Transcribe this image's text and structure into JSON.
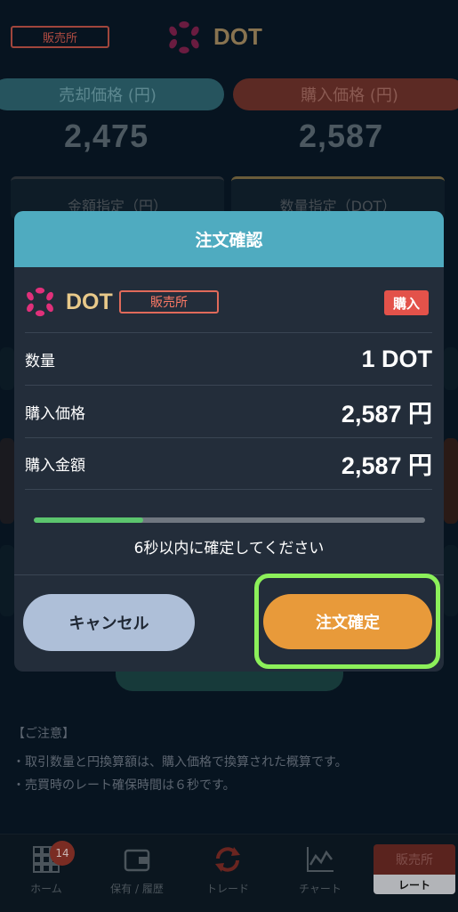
{
  "header": {
    "exchange_label": "販売所",
    "symbol": "DOT"
  },
  "prices": {
    "sell_label": "売却価格 (円)",
    "sell_value": "2,475",
    "buy_label": "購入価格 (円)",
    "buy_value": "2,587"
  },
  "modes": {
    "amount_label": "金額指定（円）",
    "quantity_label": "数量指定（DOT）"
  },
  "notice": {
    "head": "【ご注意】",
    "line1": "・取引数量と円換算額は、購入価格で換算された概算です。",
    "line2": "・売買時のレート確保時間は６秒です。"
  },
  "tabbar": {
    "home": "ホーム",
    "home_badge": "14",
    "history": "保有 / 履歴",
    "trade": "トレード",
    "chart": "チャート",
    "rate_top": "販売所",
    "rate_bottom": "レート"
  },
  "modal": {
    "title": "注文確認",
    "symbol": "DOT",
    "exchange_label": "販売所",
    "side_tag": "購入",
    "rows": [
      {
        "label": "数量",
        "value": "1 DOT"
      },
      {
        "label": "購入価格",
        "value": "2,587 円"
      },
      {
        "label": "購入金額",
        "value": "2,587 円"
      }
    ],
    "timer_progress": 0.28,
    "countdown_text": "6秒以内に確定してください",
    "cancel_label": "キャンセル",
    "confirm_label": "注文確定"
  },
  "colors": {
    "modal_header": "#4fabc0",
    "confirm": "#e89a3a",
    "cancel": "#aebfd8",
    "buy_tag": "#e3524a",
    "highlight": "#8cf05a"
  }
}
